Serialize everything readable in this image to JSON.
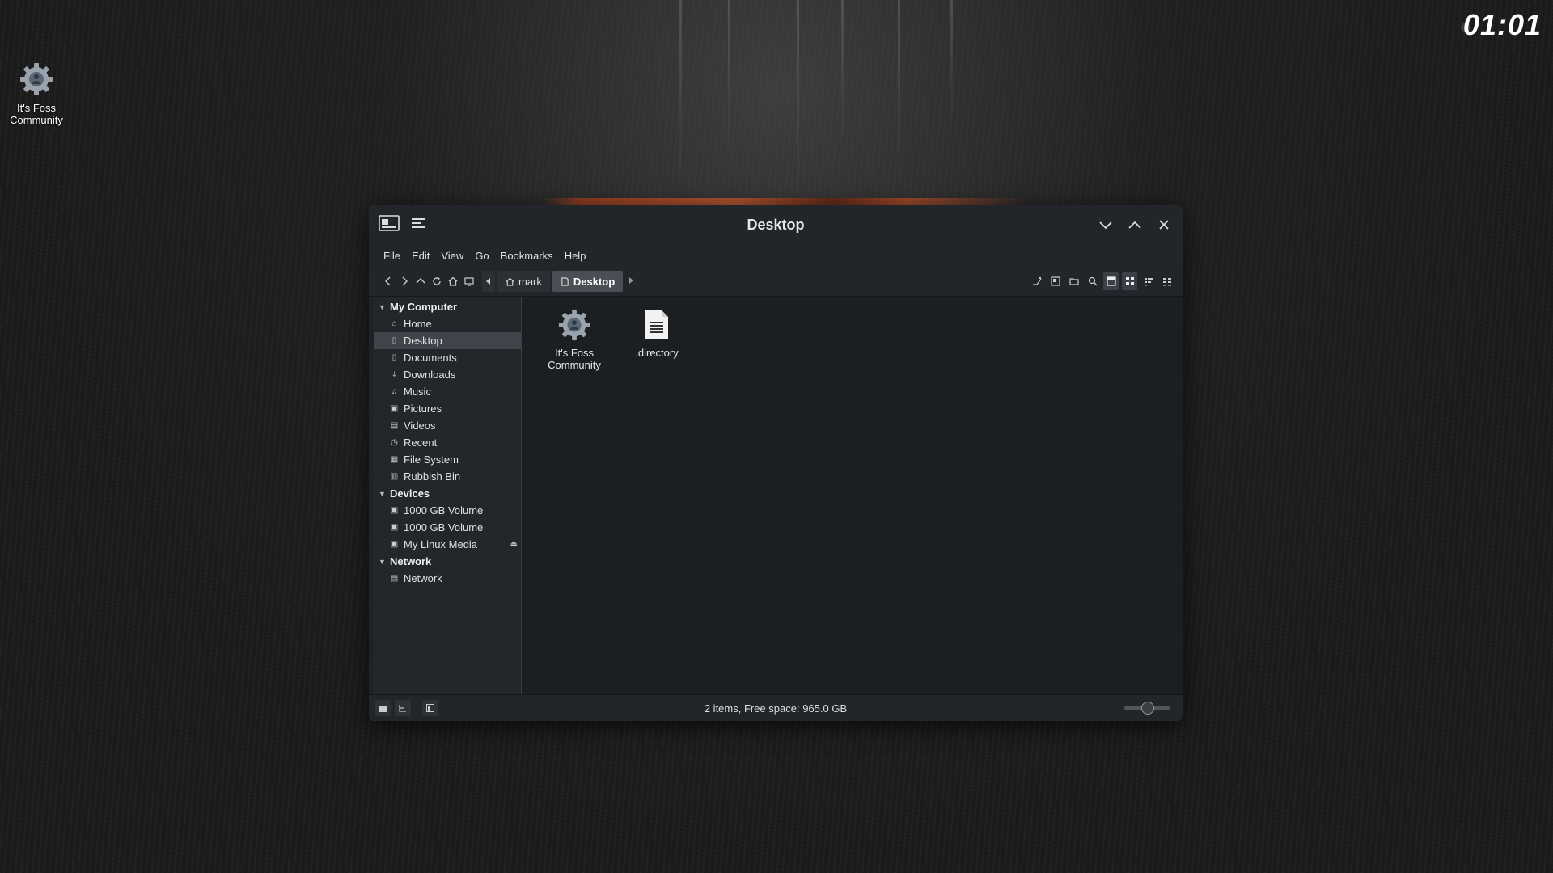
{
  "desktop": {
    "icon_label": "It's Foss Community",
    "clock": "01:01"
  },
  "window": {
    "title": "Desktop",
    "menus": [
      "File",
      "Edit",
      "View",
      "Go",
      "Bookmarks",
      "Help"
    ],
    "breadcrumb": [
      {
        "label": "mark",
        "icon": "home-icon",
        "active": false
      },
      {
        "label": "Desktop",
        "icon": "desktop-icon",
        "active": true
      }
    ],
    "sidebar": {
      "sections": [
        {
          "label": "My Computer",
          "items": [
            {
              "label": "Home",
              "icon": "home-icon"
            },
            {
              "label": "Desktop",
              "icon": "desktop-icon",
              "selected": true
            },
            {
              "label": "Documents",
              "icon": "documents-icon"
            },
            {
              "label": "Downloads",
              "icon": "downloads-icon"
            },
            {
              "label": "Music",
              "icon": "music-icon"
            },
            {
              "label": "Pictures",
              "icon": "pictures-icon"
            },
            {
              "label": "Videos",
              "icon": "videos-icon"
            },
            {
              "label": "Recent",
              "icon": "recent-icon"
            },
            {
              "label": "File System",
              "icon": "filesystem-icon"
            },
            {
              "label": "Rubbish Bin",
              "icon": "trash-icon"
            }
          ]
        },
        {
          "label": "Devices",
          "items": [
            {
              "label": "1000 GB Volume",
              "icon": "drive-icon"
            },
            {
              "label": "1000 GB Volume",
              "icon": "drive-icon"
            },
            {
              "label": "My Linux Media",
              "icon": "drive-icon",
              "eject": true
            }
          ]
        },
        {
          "label": "Network",
          "items": [
            {
              "label": "Network",
              "icon": "network-icon"
            }
          ]
        }
      ]
    },
    "files": [
      {
        "label": "It's Foss Community",
        "icon": "gear-icon"
      },
      {
        "label": ".directory",
        "icon": "text-file-icon"
      }
    ],
    "status": "2 items, Free space: 965.0 GB",
    "zoom_level": 0.5
  },
  "colors": {
    "window_bg": "#1f2327",
    "content_bg": "#1b1f22",
    "selection": "#40454b"
  }
}
